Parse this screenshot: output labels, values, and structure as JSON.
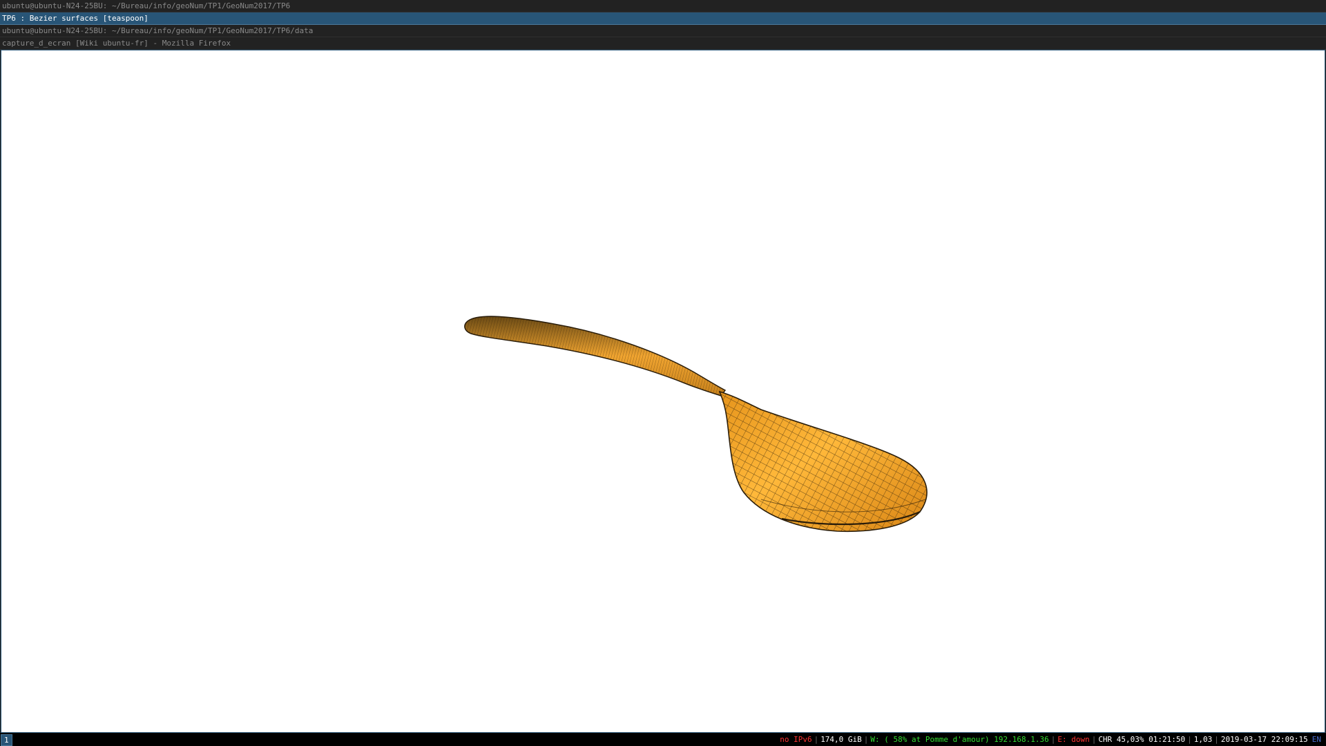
{
  "windows": {
    "terminal_1_title": "ubuntu@ubuntu-N24-25BU: ~/Bureau/info/geoNum/TP1/GeoNum2017/TP6",
    "viewer_title": "TP6 : Bezier surfaces [teaspoon]",
    "terminal_2_title": "ubuntu@ubuntu-N24-25BU: ~/Bureau/info/geoNum/TP1/GeoNum2017/TP6/data",
    "firefox_title": "capture_d_ecran [Wiki ubuntu-fr] - Mozilla Firefox"
  },
  "viewer": {
    "model": "teaspoon",
    "surface_color": "#f5a623",
    "mesh_color": "#2a1d0a"
  },
  "statusbar": {
    "workspace": "1",
    "ipv6": "no IPv6",
    "disk": "174,0 GiB",
    "wifi": "W: ( 58% at Pomme d'amour) 192.168.1.36",
    "ethernet": "E: down",
    "battery": "CHR 45,03% 01:21:50",
    "load": "1,03",
    "datetime": "2019-03-17 22:09:15",
    "keyboard_layout": "EN",
    "colors": {
      "ipv6": "#ff3333",
      "disk": "#ffffff",
      "wifi": "#33dd33",
      "ethernet": "#ff3333",
      "battery": "#ffffff",
      "load": "#ffffff",
      "datetime": "#ffffff",
      "keyboard_layout": "#4a6fd0"
    }
  }
}
